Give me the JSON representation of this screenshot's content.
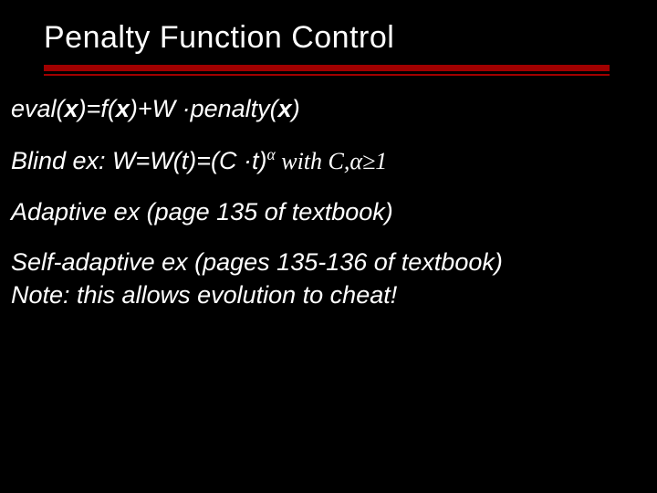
{
  "title": "Penalty Function Control",
  "eq1": {
    "p1": "eval(",
    "x1": "x",
    "p2": ")=f(",
    "x2": "x",
    "p3": ")+W ·penalty(",
    "x3": "x",
    "p4": ")"
  },
  "eq2": {
    "label": "Blind ex: W=W(t)=(C ·t)",
    "sup": "α",
    "tail": " with C,α≥1"
  },
  "adaptive": "Adaptive ex (page 135 of textbook)",
  "selfadaptive": "Self-adaptive ex (pages 135-136 of textbook)",
  "note": "Note: this allows evolution to cheat!"
}
